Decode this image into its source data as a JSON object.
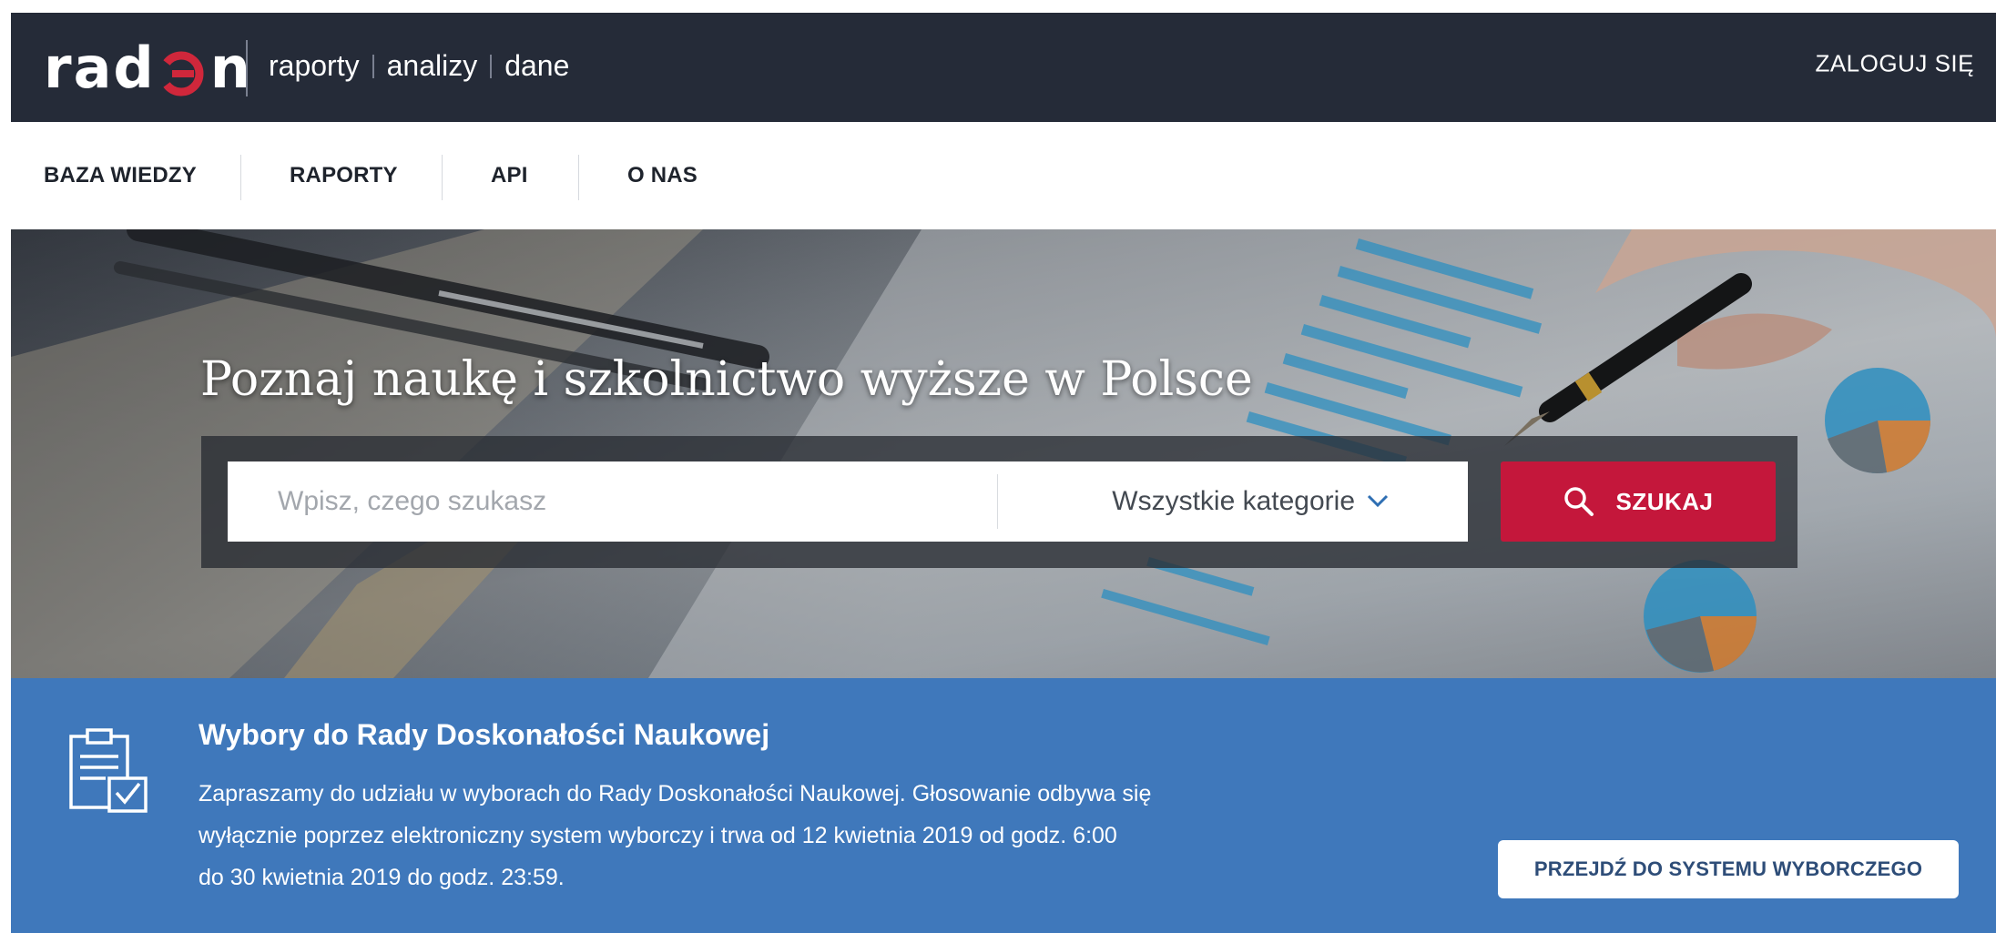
{
  "header": {
    "logo": {
      "prefix": "rad",
      "mark": "logo-mark-icon",
      "suffix": "n"
    },
    "tagline": [
      "raporty",
      "analizy",
      "dane"
    ],
    "login_label": "ZALOGUJ SIĘ"
  },
  "nav": {
    "items": [
      {
        "label": "BAZA WIEDZY"
      },
      {
        "label": "RAPORTY"
      },
      {
        "label": "API"
      },
      {
        "label": "O NAS"
      }
    ]
  },
  "hero": {
    "title": "Poznaj naukę i szkolnictwo wyższe w Polsce",
    "search": {
      "placeholder": "Wpisz, czego szukasz",
      "value": "",
      "category_selected": "Wszystkie kategorie",
      "button_label": "SZUKAJ"
    }
  },
  "banner": {
    "title": "Wybory do Rady Doskonałości Naukowej",
    "text_lines": [
      "Zapraszamy do udziału w wyborach do Rady Doskonałości Naukowej. Głosowanie odbywa się",
      "wyłącznie poprzez elektroniczny system wyborczy i trwa od 12 kwietnia 2019 od godz. 6:00",
      "do 30 kwietnia 2019 do godz. 23:59."
    ],
    "button_label": "PRZEJDŹ DO SYSTEMU WYBORCZEGO"
  },
  "colors": {
    "header_bg": "#252b38",
    "accent_red": "#c4173b",
    "banner_blue": "#3f78bb",
    "button_text": "#2e4d78"
  }
}
